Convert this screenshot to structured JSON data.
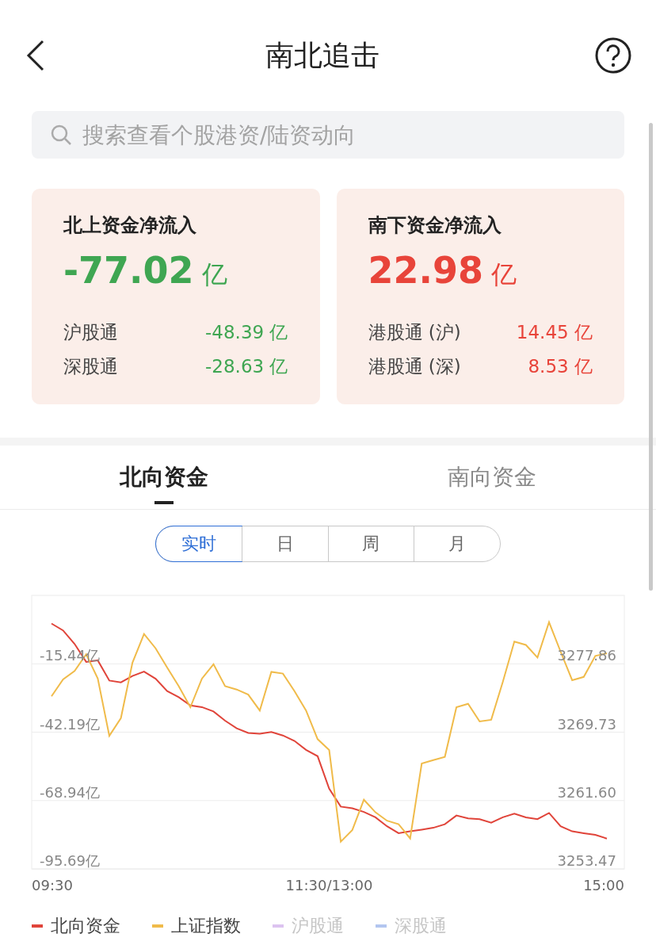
{
  "header": {
    "title": "南北追击"
  },
  "search": {
    "placeholder": "搜索查看个股港资/陆资动向"
  },
  "cards": [
    {
      "title": "北上资金净流入",
      "amount": "-77.02",
      "unit": "亿",
      "color": "#3fa652",
      "rows": [
        {
          "label": "沪股通",
          "value": "-48.39 亿",
          "color": "#3fa652"
        },
        {
          "label": "深股通",
          "value": "-28.63 亿",
          "color": "#3fa652"
        }
      ]
    },
    {
      "title": "南下资金净流入",
      "amount": "22.98",
      "unit": "亿",
      "color": "#e8443a",
      "rows": [
        {
          "label": "港股通 (沪)",
          "value": "14.45 亿",
          "color": "#e8443a"
        },
        {
          "label": "港股通 (深)",
          "value": "8.53 亿",
          "color": "#e8443a"
        }
      ]
    }
  ],
  "tabs": [
    {
      "label": "北向资金",
      "selected": true
    },
    {
      "label": "南向资金",
      "selected": false
    }
  ],
  "periods": [
    {
      "label": "实时",
      "selected": true
    },
    {
      "label": "日",
      "selected": false
    },
    {
      "label": "周",
      "selected": false
    },
    {
      "label": "月",
      "selected": false
    }
  ],
  "chart_data": {
    "type": "line",
    "grid": true,
    "categories": [
      "09:30",
      null,
      null,
      null,
      null,
      null,
      null,
      null,
      null,
      null,
      null,
      null,
      null,
      null,
      null,
      null,
      null,
      null,
      null,
      null,
      null,
      null,
      null,
      null,
      "11:30/13:00",
      null,
      null,
      null,
      null,
      null,
      null,
      null,
      null,
      null,
      null,
      null,
      null,
      null,
      null,
      null,
      null,
      null,
      null,
      null,
      null,
      null,
      null,
      null,
      "15:00"
    ],
    "ylim": [
      -95.69,
      11.31
    ],
    "yticks": [
      {
        "value": -15.44,
        "label": "-15.44亿"
      },
      {
        "value": -42.19,
        "label": "-42.19亿"
      },
      {
        "value": -68.94,
        "label": "-68.94亿"
      },
      {
        "value": -95.69,
        "label": "-95.69亿"
      }
    ],
    "y2lim": [
      3253.47,
      3285.99
    ],
    "y2ticks": [
      {
        "value": 3277.86,
        "label": "3277.86"
      },
      {
        "value": 3269.73,
        "label": "3269.73"
      },
      {
        "value": 3261.6,
        "label": "3261.60"
      },
      {
        "value": 3253.47,
        "label": "3253.47"
      }
    ],
    "series": [
      {
        "name": "北向资金",
        "color": "#e0443a",
        "values": [
          0.3,
          -2.4,
          -7.7,
          -14.7,
          -14.1,
          -22.0,
          -22.7,
          -20.2,
          -18.5,
          -21.3,
          -26.1,
          -28.5,
          -31.7,
          -32.4,
          -34.1,
          -37.7,
          -40.7,
          -42.5,
          -42.8,
          -42.1,
          -43.5,
          -45.6,
          -49.1,
          -51.6,
          -64.3,
          -71.3,
          -72.0,
          -73.4,
          -75.5,
          -79.0,
          -81.7,
          -81.0,
          -80.3,
          -79.6,
          -78.2,
          -74.8,
          -75.9,
          -76.2,
          -77.6,
          -75.5,
          -74.1,
          -75.5,
          -76.2,
          -73.8,
          -79.0,
          -81.0,
          -81.7,
          -82.4,
          -83.8
        ]
      },
      {
        "name": "上证指数",
        "color": "#f0bb4a",
        "axis": "y2",
        "values": [
          3274.0,
          3276.0,
          3277.0,
          3279.0,
          3276.1,
          3269.3,
          3271.4,
          3278.0,
          3281.4,
          3279.7,
          3277.4,
          3275.2,
          3272.7,
          3276.1,
          3277.8,
          3275.2,
          3274.8,
          3274.2,
          3272.3,
          3276.9,
          3276.7,
          3274.6,
          3272.3,
          3268.9,
          3267.6,
          3256.7,
          3258.1,
          3261.7,
          3260.2,
          3259.2,
          3258.8,
          3257.1,
          3266.0,
          3266.4,
          3266.8,
          3272.7,
          3273.1,
          3271.0,
          3271.2,
          3275.7,
          3280.5,
          3280.1,
          3278.6,
          3282.8,
          3279.3,
          3275.9,
          3276.3,
          3278.8,
          3279.1
        ]
      }
    ]
  },
  "legend_extra": [
    {
      "label": "沪股通",
      "color": "#dcc3f0",
      "on": false
    },
    {
      "label": "深股通",
      "color": "#b3c6f0",
      "on": false
    }
  ]
}
